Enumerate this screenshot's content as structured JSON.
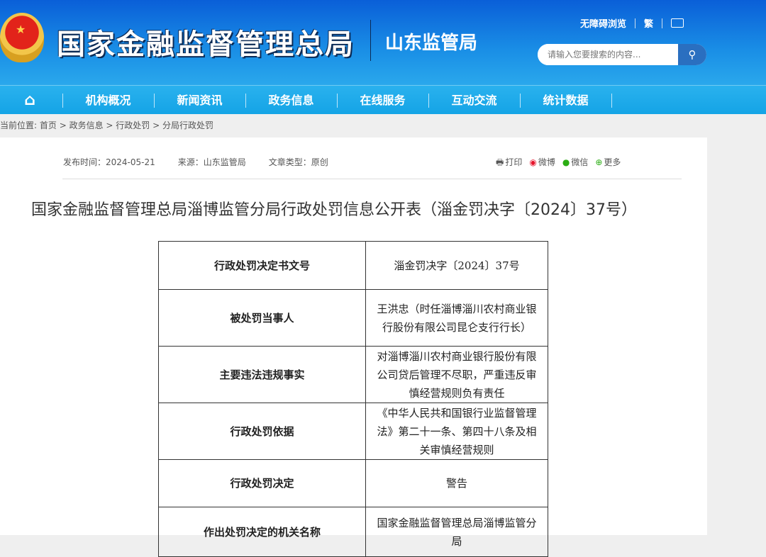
{
  "header": {
    "site_title": "国家金融监督管理总局",
    "sub_title": "山东监管局",
    "accessible": "无障碍浏览",
    "traditional": "繁",
    "search_placeholder": "请输入您要搜索的内容..."
  },
  "nav": [
    "机构概况",
    "新闻资讯",
    "政务信息",
    "在线服务",
    "互动交流",
    "统计数据"
  ],
  "breadcrumb": {
    "label": "当前位置:",
    "items": [
      "首页",
      "政务信息",
      "行政处罚",
      "分局行政处罚"
    ]
  },
  "meta": {
    "publish": "发布时间：2024-05-21",
    "source": "来源：山东监管局",
    "type": "文章类型：原创"
  },
  "share": {
    "print": "打印",
    "weibo": "微博",
    "wechat": "微信",
    "more": "更多"
  },
  "article": {
    "title": "国家金融监督管理总局淄博监管分局行政处罚信息公开表（淄金罚决字〔2024〕37号）"
  },
  "table": [
    {
      "k": "行政处罚决定书文号",
      "v": "淄金罚决字〔2024〕37号"
    },
    {
      "k": "被处罚当事人",
      "v": "王洪忠（时任淄博淄川农村商业银行股份有限公司昆仑支行行长）"
    },
    {
      "k": "主要违法违规事实",
      "v": "对淄博淄川农村商业银行股份有限公司贷后管理不尽职，严重违反审慎经营规则负有责任"
    },
    {
      "k": "行政处罚依据",
      "v": "《中华人民共和国银行业监督管理法》第二十一条、第四十八条及相关审慎经营规则"
    },
    {
      "k": "行政处罚决定",
      "v": "警告"
    },
    {
      "k": "作出处罚决定的机关名称",
      "v": "国家金融监督管理总局淄博监管分局"
    }
  ]
}
